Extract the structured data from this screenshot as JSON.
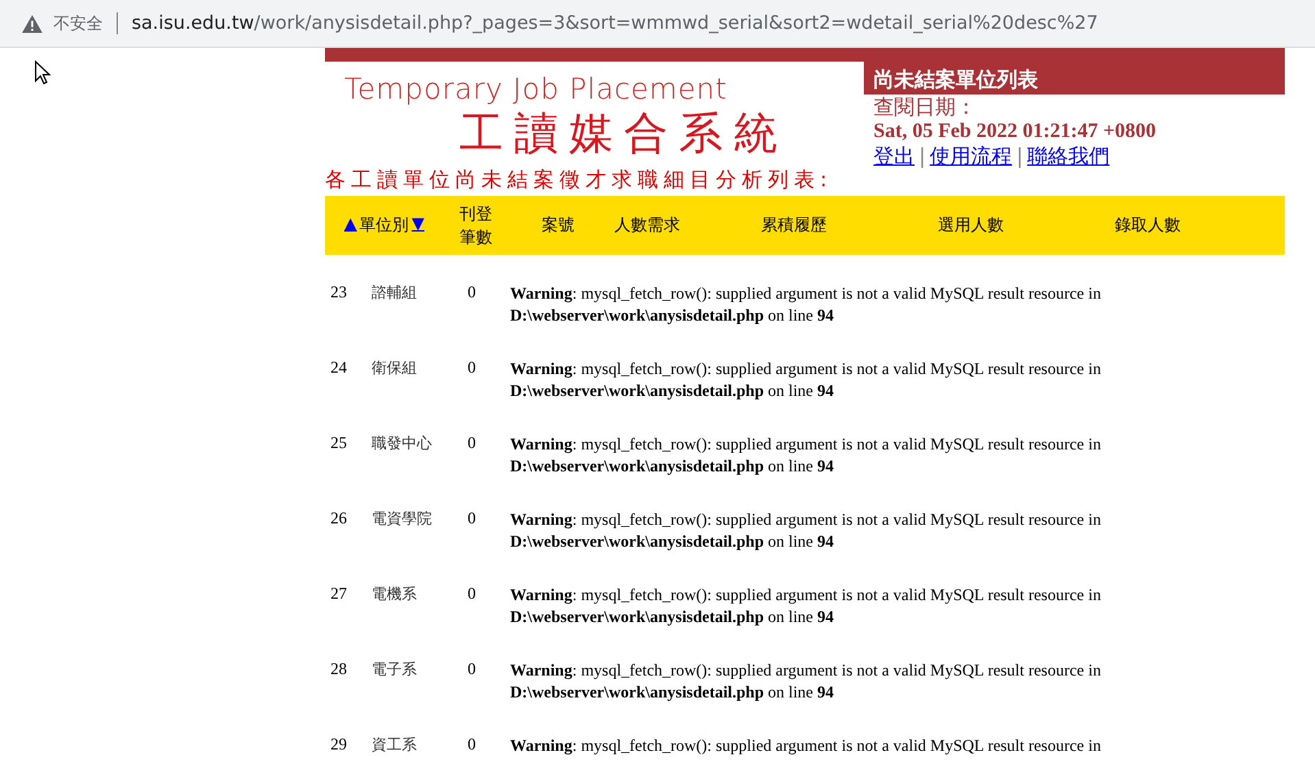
{
  "browser": {
    "security_label": "不安全",
    "url_host": "sa.isu.edu.tw",
    "url_path": "/work/anysisdetail.php?_pages=3&sort=wmmwd_serial&sort2=wdetail_serial%20desc%27"
  },
  "logo": {
    "english": "Temporary Job Placement",
    "chinese": "工讀媒合系統"
  },
  "panel": {
    "title": "尚未結案單位列表",
    "date_label": "查閱日期：",
    "date": "Sat, 05 Feb 2022 01:21:47 +0800",
    "links": [
      "登出",
      "使用流程",
      "聯絡我們"
    ],
    "link_separator": "|"
  },
  "page_title": "各工讀單位尚未結案徵才求職細目分析列表:",
  "table": {
    "sort_up": "▲",
    "sort_down": "▼",
    "columns": [
      "單位別",
      "刊登筆數",
      "案號",
      "人數需求",
      "累積履歷",
      "選用人數",
      "錄取人數"
    ],
    "rows": [
      {
        "number": "23",
        "unit": "諮輔組",
        "count": "0",
        "message": "**Warning**: mysql_fetch_row(): supplied argument is not a valid MySQL result resource in",
        "location": "**D:\\webserver\\work\\anysisdetail.php** on line **94**"
      },
      {
        "number": "24",
        "unit": "衛保組",
        "count": "0",
        "message": "**Warning**: mysql_fetch_row(): supplied argument is not a valid MySQL result resource in",
        "location": "**D:\\webserver\\work\\anysisdetail.php** on line **94**"
      },
      {
        "number": "25",
        "unit": "職發中心",
        "count": "0",
        "message": "**Warning**: mysql_fetch_row(): supplied argument is not a valid MySQL result resource in",
        "location": "**D:\\webserver\\work\\anysisdetail.php** on line **94**"
      },
      {
        "number": "26",
        "unit": "電資學院",
        "count": "0",
        "message": "**Warning**: mysql_fetch_row(): supplied argument is not a valid MySQL result resource in",
        "location": "**D:\\webserver\\work\\anysisdetail.php** on line **94**"
      },
      {
        "number": "27",
        "unit": "電機系",
        "count": "0",
        "message": "**Warning**: mysql_fetch_row(): supplied argument is not a valid MySQL result resource in",
        "location": "**D:\\webserver\\work\\anysisdetail.php** on line **94**"
      },
      {
        "number": "28",
        "unit": "電子系",
        "count": "0",
        "message": "**Warning**: mysql_fetch_row(): supplied argument is not a valid MySQL result resource in",
        "location": "**D:\\webserver\\work\\anysisdetail.php** on line **94**"
      },
      {
        "number": "29",
        "unit": "資工系",
        "count": "0",
        "message": "**Warning**: mysql_fetch_row(): supplied argument is not a valid MySQL result resource in"
      }
    ]
  }
}
